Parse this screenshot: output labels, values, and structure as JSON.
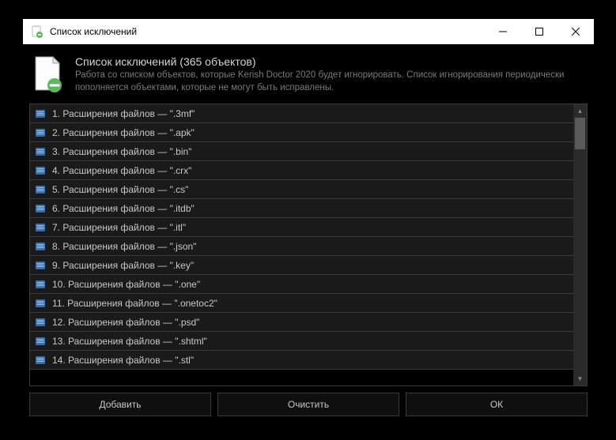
{
  "window": {
    "title": "Список исключений"
  },
  "header": {
    "title": "Список исключений (365 объектов)",
    "description": "Работа со списком объектов, которые Kerish Doctor 2020 будет игнорировать. Список игнорирования периодически пополняется объектами, которые не могут быть исправлены."
  },
  "list": {
    "items": [
      {
        "label": "1. Расширения файлов — \".3mf\""
      },
      {
        "label": "2. Расширения файлов — \".apk\""
      },
      {
        "label": "3. Расширения файлов — \".bin\""
      },
      {
        "label": "4. Расширения файлов — \".crx\""
      },
      {
        "label": "5. Расширения файлов — \".cs\""
      },
      {
        "label": "6. Расширения файлов — \".itdb\""
      },
      {
        "label": "7. Расширения файлов — \".itl\""
      },
      {
        "label": "8. Расширения файлов — \".json\""
      },
      {
        "label": "9. Расширения файлов — \".key\""
      },
      {
        "label": "10. Расширения файлов — \".one\""
      },
      {
        "label": "11. Расширения файлов — \".onetoc2\""
      },
      {
        "label": "12. Расширения файлов — \".psd\""
      },
      {
        "label": "13. Расширения файлов — \".shtml\""
      },
      {
        "label": "14. Расширения файлов — \".stl\""
      }
    ]
  },
  "buttons": {
    "add": "Добавить",
    "clear": "Очистить",
    "ok": "ОК"
  }
}
